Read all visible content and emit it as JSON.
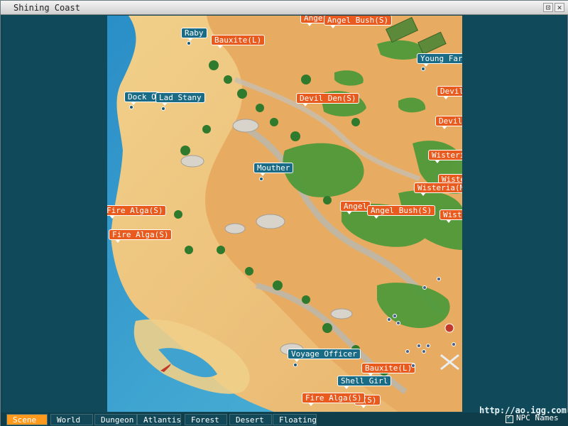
{
  "window": {
    "title": "Shining Coast"
  },
  "tabs": [
    {
      "label": "Scene",
      "active": true
    },
    {
      "label": "World"
    },
    {
      "label": "Dungeon"
    },
    {
      "label": "Atlantis"
    },
    {
      "label": "Forest"
    },
    {
      "label": "Desert"
    },
    {
      "label": "Floating"
    }
  ],
  "footer": {
    "watermark": "http://ao.igg.com",
    "npc_names_label": "NPC Names"
  },
  "labels": [
    {
      "text": "Ange",
      "color": "orange"
    },
    {
      "text": "Angel Bush(S)",
      "color": "orange"
    },
    {
      "text": "Raby",
      "color": "blue"
    },
    {
      "text": "Bauxite(L)",
      "color": "orange"
    },
    {
      "text": "Young Farmer",
      "color": "blue"
    },
    {
      "text": "Dock O",
      "color": "blue"
    },
    {
      "text": "Lad Stany",
      "color": "blue"
    },
    {
      "text": "Devil Den(S)",
      "color": "orange"
    },
    {
      "text": "Devil Den(S)",
      "color": "orange"
    },
    {
      "text": "Devil Den(S)",
      "color": "orange"
    },
    {
      "text": "Wisteria(M)",
      "color": "orange"
    },
    {
      "text": "Mouther",
      "color": "blue"
    },
    {
      "text": "Wisteria(L)",
      "color": "orange"
    },
    {
      "text": "Wisteria(M)",
      "color": "orange"
    },
    {
      "text": "Fire Alga(S)",
      "color": "orange"
    },
    {
      "text": "Angel",
      "color": "orange"
    },
    {
      "text": "Angel Bush(S)",
      "color": "orange"
    },
    {
      "text": "Wisteria(L)",
      "color": "orange"
    },
    {
      "text": "Fire Alga(S)",
      "color": "orange"
    },
    {
      "text": "Voyage Officer",
      "color": "blue"
    },
    {
      "text": "Bauxite(L)",
      "color": "orange"
    },
    {
      "text": "Shell Girl",
      "color": "blue"
    },
    {
      "text": "Fire Alga(S)",
      "color": "orange"
    },
    {
      "text": "a(S)",
      "color": "orange"
    }
  ]
}
